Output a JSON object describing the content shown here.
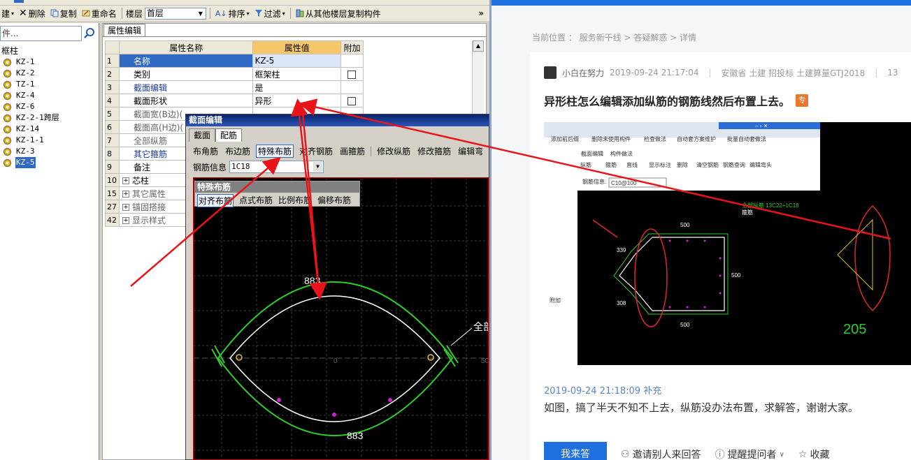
{
  "toolbar": {
    "partial_left": "建",
    "delete": "删除",
    "copy": "复制",
    "rename": "重命名",
    "floor_label": "楼层",
    "floor_value": "首层",
    "sort": "排序",
    "filter": "过滤",
    "copy_from_other_floor": "从其他楼层复制构件",
    "overflow": "»"
  },
  "tree": {
    "search_placeholder": "件...",
    "root": "框柱",
    "items": [
      "KZ-1",
      "KZ-2",
      "TZ-1",
      "KZ-4",
      "KZ-6",
      "KZ-2-1跨层",
      "KZ-14",
      "KZ-1-1",
      "KZ-3",
      "KZ-5"
    ],
    "selected": "KZ-5"
  },
  "props": {
    "tab": "属性编辑",
    "headers": {
      "name": "属性名称",
      "value": "属性值",
      "extra": "附加"
    },
    "rows": [
      {
        "n": "1",
        "name": "名称",
        "value": "KZ-5",
        "check": false
      },
      {
        "n": "2",
        "name": "类别",
        "value": "框架柱",
        "check": true
      },
      {
        "n": "3",
        "name": "截面编辑",
        "value": "是",
        "check": false
      },
      {
        "n": "4",
        "name": "截面形状",
        "value": "异形",
        "check": true
      },
      {
        "n": "5",
        "name": "截面宽(B边)(",
        "value": "",
        "check": false
      },
      {
        "n": "6",
        "name": "截面高(H边)(",
        "value": "",
        "check": false
      },
      {
        "n": "7",
        "name": "全部纵筋",
        "value": "",
        "check": false
      },
      {
        "n": "8",
        "name": "其它箍筋",
        "value": "",
        "check": false
      },
      {
        "n": "9",
        "name": "备注",
        "value": "",
        "check": false
      },
      {
        "n": "10",
        "name": "芯柱",
        "value": "",
        "check": false
      },
      {
        "n": "15",
        "name": "其它属性",
        "value": "",
        "check": false
      },
      {
        "n": "27",
        "name": "锚固搭接",
        "value": "",
        "check": false
      },
      {
        "n": "42",
        "name": "显示样式",
        "value": "",
        "check": false
      }
    ]
  },
  "dialog": {
    "title": "截面编辑",
    "tabs": [
      "截面",
      "配筋"
    ],
    "toolbar": [
      "布角筋",
      "布边筋",
      "特殊布筋",
      "对齐钢筋",
      "画箍筋",
      "修改纵筋",
      "修改箍筋",
      "编辑弯"
    ],
    "rebar_label": "钢筋信息",
    "rebar_value": "1C18",
    "special_title": "特殊布筋",
    "special_buttons": [
      "对齐布筋",
      "点式布筋",
      "比例布筋",
      "偏移布筋"
    ],
    "dim_top": "883",
    "dim_bottom": "883",
    "label_right": "全部",
    "center_mark": "0",
    "right_mark": "50"
  },
  "web": {
    "breadcrumb": "当前位置 ： 服务新干线 > 答疑解惑 > 详情",
    "author": "小白在努力",
    "datetime": "2019-09-24 21:17:04",
    "separator": "|",
    "tags": "安徽省  土建  招投标  土建算量GTJ2018",
    "views": "13",
    "title": "异形柱怎么编辑添加纵筋的钢筋线然后布置上去。",
    "title_tag": "专",
    "supplement_time": "2019-09-24 21:18:09 补充",
    "supplement_text": "如图，搞了半天不知不上去，纵筋没办法布置，求解答，谢谢大家。",
    "answer_button": "我来答",
    "invite": "邀请别人来回答",
    "remind": "提醒提问者",
    "favorite": "收藏"
  },
  "embedded": {
    "toolbar_items": [
      "添加前后缀",
      "删除未使用构件",
      "检查做法",
      "自动套方案维护",
      "批量自动套做法"
    ],
    "tabs": [
      "截面编辑",
      "构件做法"
    ],
    "options": [
      "纵筋",
      "箍筋",
      "直线",
      "显示标注",
      "删除",
      "清空钢筋",
      "钢筋查询",
      "编辑弯头"
    ],
    "rebar_label": "钢筋信息:",
    "rebar_value": "C10@100",
    "note1": "全部纵筋 13C22+1C18",
    "note2": "箍筋",
    "dim_500_top": "500",
    "dim_500_bottom": "500",
    "dim_339": "339",
    "dim_308": "308",
    "dim_side": "500",
    "dim_205": "205",
    "extra_col": "附加"
  }
}
